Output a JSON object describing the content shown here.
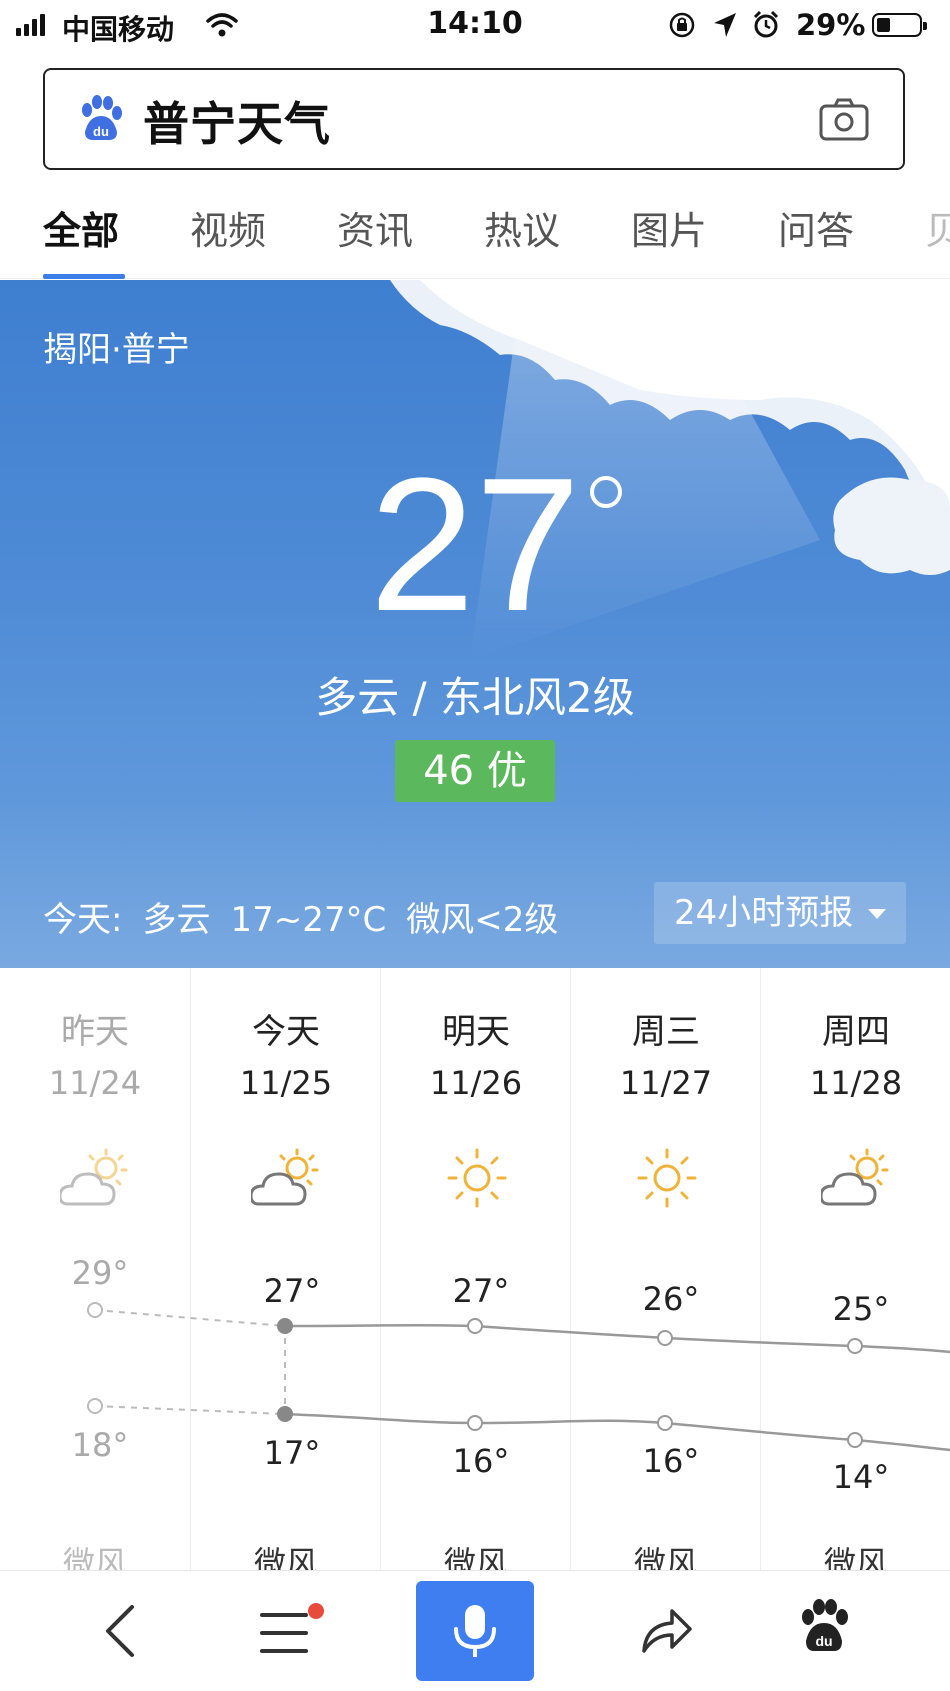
{
  "status_bar": {
    "carrier": "中国移动",
    "time": "14:10",
    "battery": "29%"
  },
  "search": {
    "query": "普宁天气"
  },
  "tabs": [
    {
      "label": "全部",
      "active": true
    },
    {
      "label": "视频"
    },
    {
      "label": "资讯"
    },
    {
      "label": "热议"
    },
    {
      "label": "图片"
    },
    {
      "label": "问答"
    }
  ],
  "weather": {
    "location": "揭阳·普宁",
    "current_temp": "27",
    "condition": "多云 / 东北风2级",
    "aqi": "46 优",
    "aqi_color": "#5cb85c",
    "today": {
      "label": "今天:",
      "condition": "多云",
      "range": "17~27°C",
      "wind": "微风<2级"
    },
    "forecast_button": "24小时预报",
    "accent": "#3f7ef0"
  },
  "forecast": [
    {
      "day": "昨天",
      "date": "11/24",
      "icon": "partly-cloudy-icon",
      "high": "29°",
      "low": "18°",
      "wind": "微风",
      "past": true
    },
    {
      "day": "今天",
      "date": "11/25",
      "icon": "partly-cloudy-icon",
      "high": "27°",
      "low": "17°",
      "wind": "微风"
    },
    {
      "day": "明天",
      "date": "11/26",
      "icon": "sunny-icon",
      "high": "27°",
      "low": "16°",
      "wind": "微风"
    },
    {
      "day": "周三",
      "date": "11/27",
      "icon": "sunny-icon",
      "high": "26°",
      "low": "16°",
      "wind": "微风"
    },
    {
      "day": "周四",
      "date": "11/28",
      "icon": "partly-cloudy-icon",
      "high": "25°",
      "low": "14°",
      "wind": "微风"
    }
  ]
}
